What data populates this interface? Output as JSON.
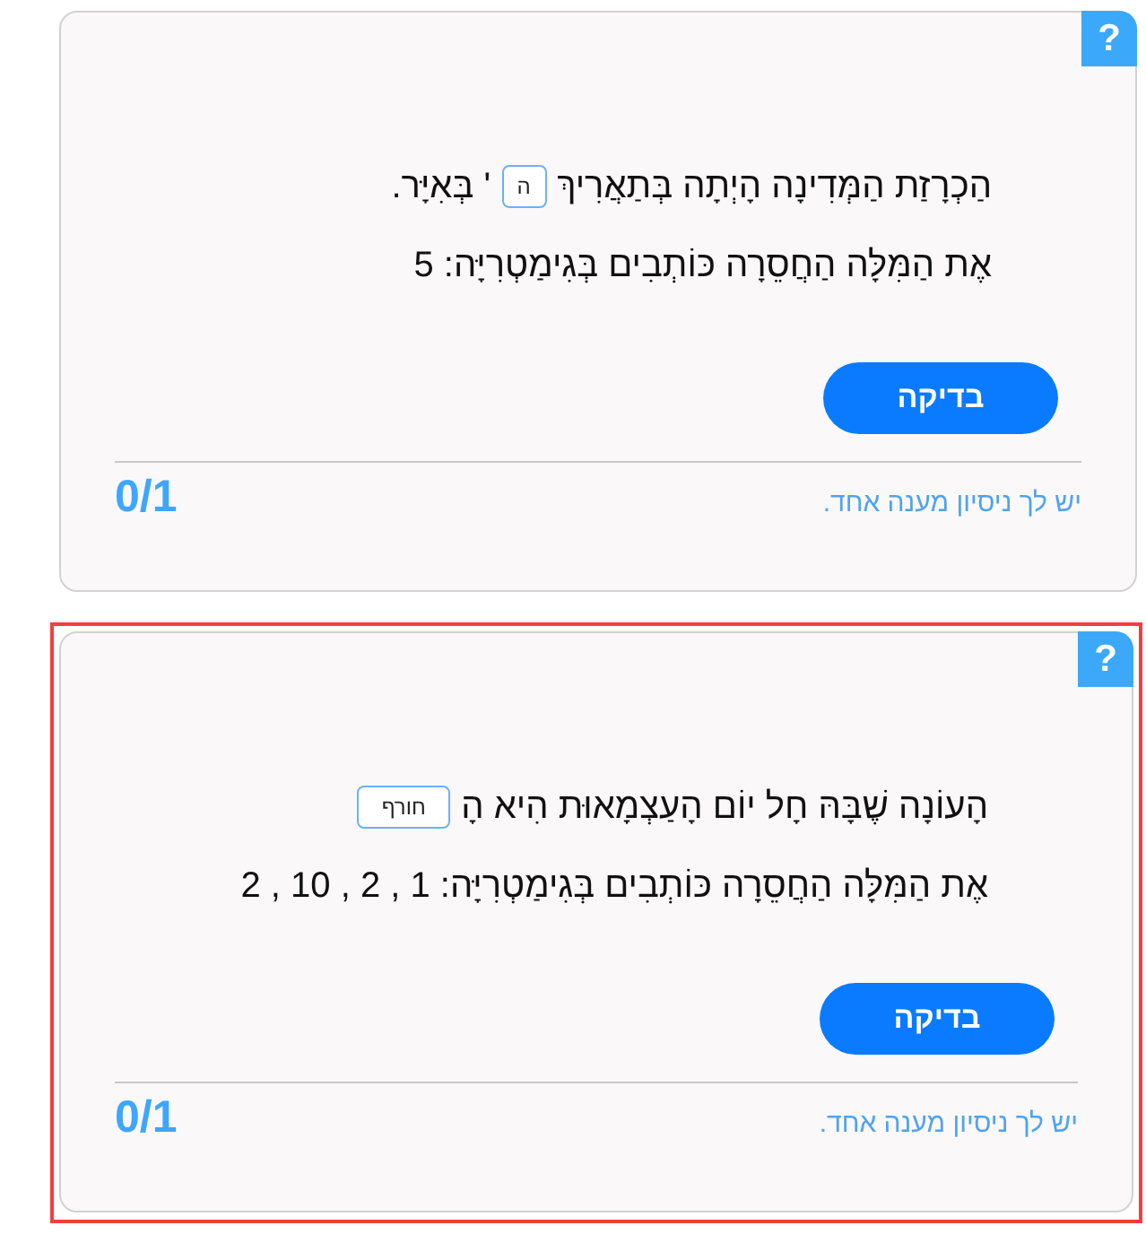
{
  "questions": [
    {
      "highlighted": false,
      "help_badge": "?",
      "sentence": [
        {
          "kind": "text",
          "text": "הַכְרָזַת הַמְּדִינָה הָיְתָה בְּתַאֲרִיךְ"
        },
        {
          "kind": "field",
          "value": "ה"
        },
        {
          "kind": "text",
          "text": "' בְּאִיָּר."
        }
      ],
      "hint": "אֶת הַמִּלָּה הַחֲסֵרָה כּוֹתְבִים בְּגִימַטְרִיָּה: 5",
      "check_button": "בדיקה",
      "attempts_note": "יש לך ניסיון מענה אחד.",
      "score": "0/1"
    },
    {
      "highlighted": true,
      "help_badge": "?",
      "sentence": [
        {
          "kind": "text",
          "text": "הָעוֹנָה שֶׁבָּהּ חָל יוֹם הָעַצְמָאוּת הִיא הָ"
        },
        {
          "kind": "field",
          "value": "חורף"
        }
      ],
      "hint": "אֶת הַמִּלָּה הַחֲסֵרָה כּוֹתְבִים בְּגִימַטְרִיָּה: 1 , 2 , 10 , 2",
      "check_button": "בדיקה",
      "attempts_note": "יש לך ניסיון מענה אחד.",
      "score": "0/1"
    }
  ]
}
